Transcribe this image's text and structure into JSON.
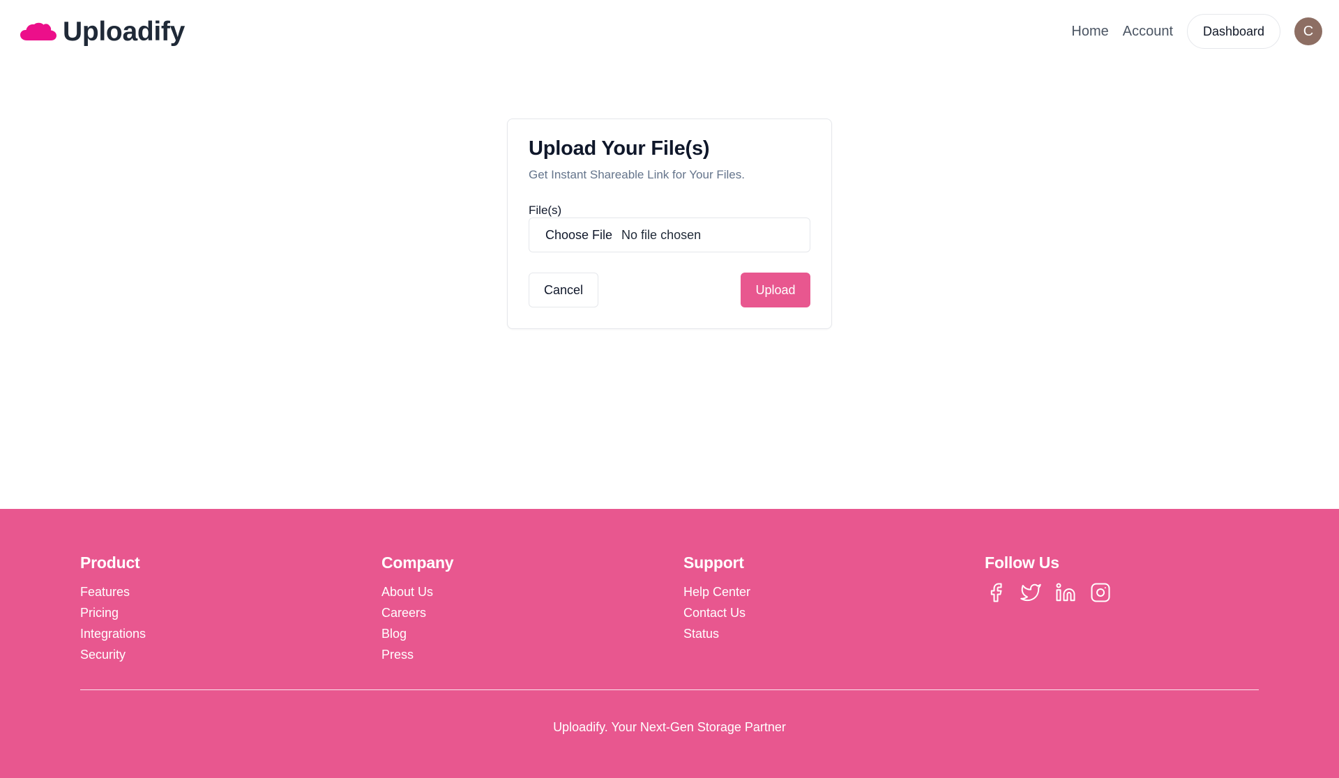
{
  "header": {
    "brand_name": "Uploadify",
    "nav": {
      "home": "Home",
      "account": "Account",
      "dashboard": "Dashboard"
    },
    "avatar_initial": "C"
  },
  "upload_card": {
    "title": "Upload Your File(s)",
    "subtitle": "Get Instant Shareable Link for Your Files.",
    "file_label": "File(s)",
    "choose_button": "Choose File",
    "no_file_text": "No file chosen",
    "cancel_label": "Cancel",
    "upload_label": "Upload"
  },
  "footer": {
    "product": {
      "title": "Product",
      "links": [
        "Features",
        "Pricing",
        "Integrations",
        "Security"
      ]
    },
    "company": {
      "title": "Company",
      "links": [
        "About Us",
        "Careers",
        "Blog",
        "Press"
      ]
    },
    "support": {
      "title": "Support",
      "links": [
        "Help Center",
        "Contact Us",
        "Status"
      ]
    },
    "follow": {
      "title": "Follow Us",
      "icons": [
        "facebook-icon",
        "twitter-icon",
        "linkedin-icon",
        "instagram-icon"
      ]
    },
    "tagline": "Uploadify. Your Next-Gen Storage Partner"
  },
  "colors": {
    "brand_pink": "#e8578f",
    "logo_pink": "#ec0f8a",
    "avatar_bg": "#8d6e63"
  }
}
